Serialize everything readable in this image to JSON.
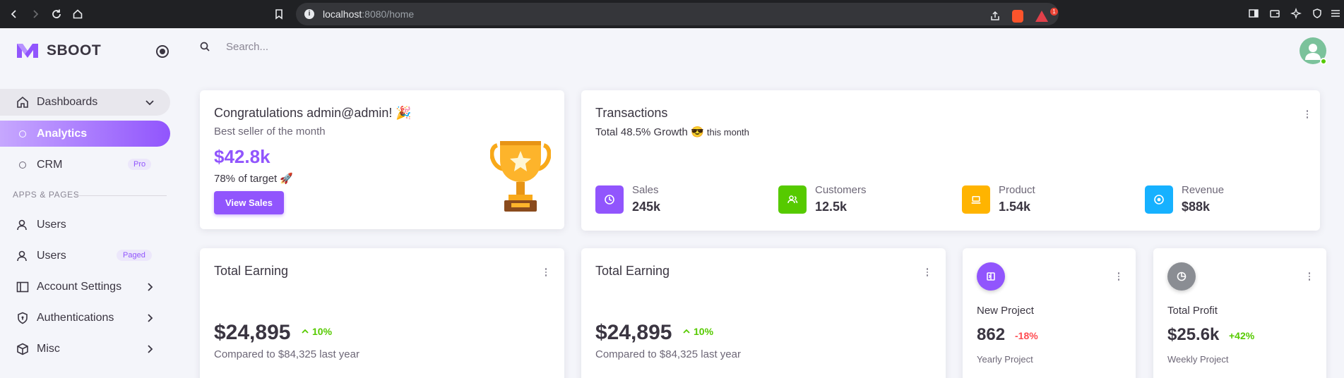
{
  "browser": {
    "url_host": "localhost",
    "url_rest": ":8080/home",
    "rewards_count": "1"
  },
  "brand": {
    "name": "SBOOT"
  },
  "sidebar": {
    "dashboards_label": "Dashboards",
    "analytics_label": "Analytics",
    "crm_label": "CRM",
    "crm_badge": "Pro",
    "section_header": "APPS & PAGES",
    "items": [
      {
        "label": "Users"
      },
      {
        "label": "Users",
        "badge": "Paged"
      },
      {
        "label": "Account Settings"
      },
      {
        "label": "Authentications"
      },
      {
        "label": "Misc"
      }
    ]
  },
  "search": {
    "placeholder": "Search..."
  },
  "congrats": {
    "title": "Congratulations admin@admin! 🎉",
    "subtitle": "Best seller of the month",
    "amount": "$42.8k",
    "target": "78% of target 🚀",
    "button": "View Sales"
  },
  "transactions": {
    "title": "Transactions",
    "growth": "Total 48.5% Growth 😎",
    "period": "this month",
    "stats": [
      {
        "label": "Sales",
        "value": "245k",
        "color": "#9155fd",
        "icon": "trending-up-icon"
      },
      {
        "label": "Customers",
        "value": "12.5k",
        "color": "#56ca00",
        "icon": "account-icon"
      },
      {
        "label": "Product",
        "value": "1.54k",
        "color": "#ffb400",
        "icon": "cellphone-icon"
      },
      {
        "label": "Revenue",
        "value": "$88k",
        "color": "#16b1ff",
        "icon": "currency-icon"
      }
    ]
  },
  "earnings": [
    {
      "title": "Total Earning",
      "amount": "$24,895",
      "change": "10%",
      "compare": "Compared to $84,325 last year"
    },
    {
      "title": "Total Earning",
      "amount": "$24,895",
      "change": "10%",
      "compare": "Compared to $84,325 last year"
    }
  ],
  "new_project": {
    "title": "New Project",
    "value": "862",
    "change": "-18%",
    "footer": "Yearly Project",
    "color": "#9155fd",
    "change_color": "#ff4c51"
  },
  "total_profit": {
    "title": "Total Profit",
    "value": "$25.6k",
    "change": "+42%",
    "footer": "Weekly Project",
    "color": "#8a8d93",
    "change_color": "#56ca00"
  }
}
